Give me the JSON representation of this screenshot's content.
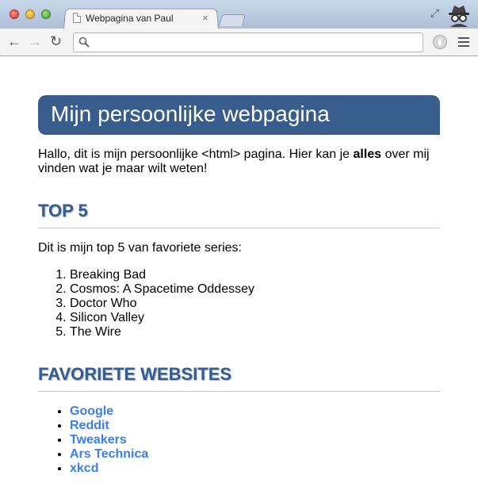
{
  "browser": {
    "tab_title": "Webpagina van Paul",
    "tab_close": "×",
    "address": "",
    "address_placeholder": ""
  },
  "toolbar": {
    "back_label": "←",
    "forward_label": "→",
    "reload_label": "↻"
  },
  "page": {
    "header": "Mijn persoonlijke webpagina",
    "intro_before": "Hallo, dit is mijn persoonlijke <html> pagina. Hier kan je ",
    "intro_bold": "alles",
    "intro_after": " over mij vinden wat je maar wilt weten!",
    "top5": {
      "title": "TOP 5",
      "text": "Dit is mijn top 5 van favoriete series:",
      "items": [
        "Breaking Bad",
        "Cosmos: A Spacetime Oddessey",
        "Doctor Who",
        "Silicon Valley",
        "The Wire"
      ]
    },
    "websites": {
      "title": "FAVORIETE WEBSITES",
      "items": [
        "Google",
        "Reddit",
        "Tweakers",
        "Ars Technica",
        "xkcd"
      ]
    }
  },
  "colors": {
    "accent": "#385d8c",
    "link": "#3b7ef0"
  }
}
